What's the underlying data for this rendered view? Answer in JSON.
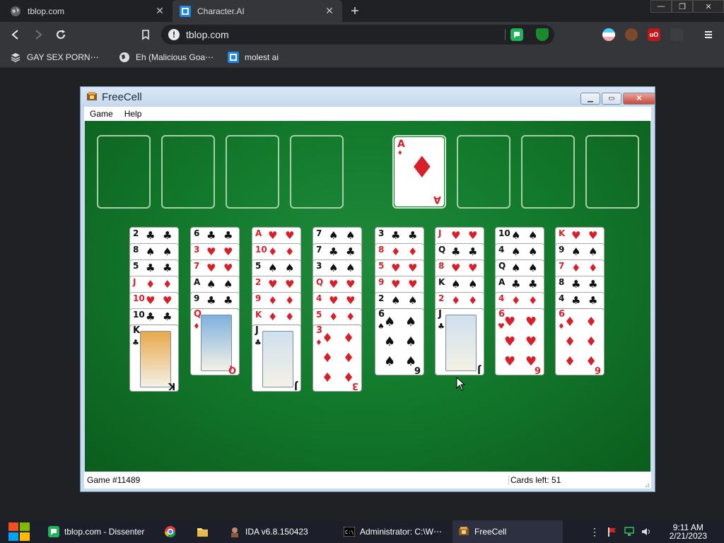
{
  "browser": {
    "tabs": [
      {
        "title": "tblop.com",
        "active": false
      },
      {
        "title": "Character.AI",
        "active": true
      }
    ],
    "address": "tblop.com",
    "bookmarks": [
      {
        "label": "GAY SEX PORN⋯"
      },
      {
        "label": "Eh (Malicious Goa⋯"
      },
      {
        "label": "molest ai"
      }
    ]
  },
  "freecell": {
    "title": "FreeCell",
    "menu": [
      "Game",
      "Help"
    ],
    "status": {
      "game": "Game #11489",
      "cards_left": "Cards left: 51"
    },
    "foundation": [
      {
        "rank": "A",
        "suit": "♦"
      }
    ],
    "columns": [
      {
        "strips": [
          [
            "2",
            "♣"
          ],
          [
            "8",
            "♠"
          ],
          [
            "5",
            "♣"
          ],
          [
            "J",
            "♦"
          ],
          [
            "10",
            "♥"
          ],
          [
            "10",
            "♣"
          ]
        ],
        "last": [
          "K",
          "♣"
        ]
      },
      {
        "strips": [
          [
            "6",
            "♣"
          ],
          [
            "3",
            "♥"
          ],
          [
            "7",
            "♥"
          ],
          [
            "A",
            "♠"
          ],
          [
            "9",
            "♣"
          ]
        ],
        "last": [
          "Q",
          "♦"
        ]
      },
      {
        "strips": [
          [
            "A",
            "♥"
          ],
          [
            "10",
            "♦"
          ],
          [
            "5",
            "♠"
          ],
          [
            "2",
            "♥"
          ],
          [
            "9",
            "♦"
          ],
          [
            "K",
            "♦"
          ]
        ],
        "last": [
          "J",
          "♣"
        ]
      },
      {
        "strips": [
          [
            "7",
            "♠"
          ],
          [
            "7",
            "♣"
          ],
          [
            "3",
            "♠"
          ],
          [
            "Q",
            "♥"
          ],
          [
            "4",
            "♥"
          ],
          [
            "5",
            "♦"
          ]
        ],
        "last": [
          "3",
          "♦"
        ]
      },
      {
        "strips": [
          [
            "3",
            "♣"
          ],
          [
            "8",
            "♦"
          ],
          [
            "5",
            "♥"
          ],
          [
            "9",
            "♥"
          ],
          [
            "2",
            "♠"
          ]
        ],
        "last": [
          "6",
          "♠"
        ]
      },
      {
        "strips": [
          [
            "J",
            "♥"
          ],
          [
            "Q",
            "♣"
          ],
          [
            "8",
            "♥"
          ],
          [
            "K",
            "♠"
          ],
          [
            "2",
            "♦"
          ]
        ],
        "last": [
          "J",
          "♣"
        ]
      },
      {
        "strips": [
          [
            "10",
            "♠"
          ],
          [
            "4",
            "♠"
          ],
          [
            "Q",
            "♠"
          ],
          [
            "A",
            "♣"
          ],
          [
            "4",
            "♦"
          ]
        ],
        "last": [
          "6",
          "♥"
        ]
      },
      {
        "strips": [
          [
            "K",
            "♥"
          ],
          [
            "9",
            "♠"
          ],
          [
            "7",
            "♦"
          ],
          [
            "8",
            "♣"
          ],
          [
            "4",
            "♣"
          ]
        ],
        "last": [
          "6",
          "♦"
        ]
      }
    ]
  },
  "taskbar": {
    "items": [
      {
        "label": "tblop.com - Dissenter"
      },
      {
        "label": "IDA v6.8.150423"
      },
      {
        "label": "Administrator: C:\\W⋯"
      },
      {
        "label": "FreeCell"
      }
    ],
    "time": "9:11 AM",
    "date": "2/21/2023"
  },
  "colors": {
    "felt": "#137a2c",
    "red_suit": "#d8202a",
    "chrome_dark": "#202124"
  }
}
